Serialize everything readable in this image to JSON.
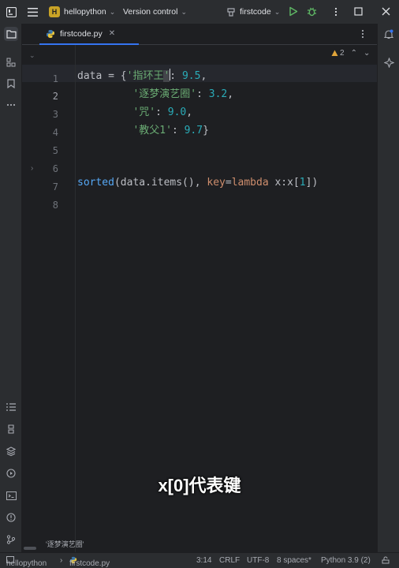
{
  "titlebar": {
    "project_badge": "H",
    "project_name": "hellopython",
    "vcs_label": "Version control",
    "run_config": "firstcode"
  },
  "editor": {
    "tab_label": "firstcode.py",
    "inspection_count": "2",
    "line_numbers": [
      "1",
      "2",
      "3",
      "4",
      "5",
      "6",
      "7",
      "8"
    ],
    "current_line": "2"
  },
  "code": {
    "l2_a": "data = {",
    "l2_str_open": "'",
    "l2_str_text": "指环王",
    "l2_str_close": "'",
    "l2_colon": ": ",
    "l2_num": "9.5",
    "l2_end": ",",
    "l3_indent": "         ",
    "l3_str": "'逐梦演艺圈'",
    "l3_colon": ": ",
    "l3_num": "3.2",
    "l3_end": ",",
    "l4_indent": "         ",
    "l4_str": "'咒'",
    "l4_colon": ": ",
    "l4_num": "9.0",
    "l4_end": ",",
    "l5_indent": "         ",
    "l5_str": "'教父1'",
    "l5_colon": ": ",
    "l5_num": "9.7",
    "l5_end": "}",
    "l8_fn": "sorted",
    "l8_a": "(data.items(), ",
    "l8_kw": "key",
    "l8_eq": "=",
    "l8_lambda": "lambda",
    "l8_b": " x:x[",
    "l8_num": "1",
    "l8_c": "])"
  },
  "hint_popup": "'逐梦演艺圈'",
  "subtitle": "x[0]代表键",
  "statusbar": {
    "project": "hellopython",
    "file": "firstcode.py",
    "position": "3:14",
    "line_sep": "CRLF",
    "encoding": "UTF-8",
    "indent": "8 spaces*",
    "interpreter": "Python 3.9 (2)"
  },
  "colors": {
    "accent": "#3574f0",
    "string": "#6aab73",
    "number": "#2aacb8",
    "keyword": "#cf8e6d",
    "function": "#56a8f5"
  }
}
